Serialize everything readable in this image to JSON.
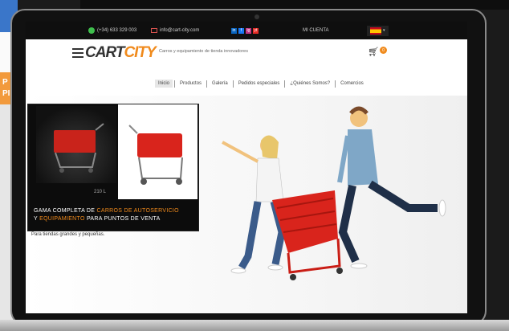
{
  "topbar": {
    "phone": "(+34) 633 329 003",
    "email": "info@cart-city.com",
    "account": "MI CUENTA",
    "socials": [
      "in",
      "f",
      "ig",
      "yt"
    ]
  },
  "header": {
    "logo_cart": "CART",
    "logo_city": "CITY",
    "tagline": "Carros y equipamiento de tienda innovadores",
    "cart_count": "0"
  },
  "nav": [
    "Inicio",
    "Productos",
    "Galería",
    "Pedidos especiales",
    "¿Quiénes Somos?",
    "Comercios"
  ],
  "promo": {
    "size_label": "210 L",
    "line1_a": "GAMA COMPLETA DE ",
    "line1_b": "CARROS DE AUTOSERVICIO",
    "line2_a": "Y ",
    "line2_b": "EQUIPAMIENTO",
    "line2_c": " PARA PUNTOS DE VENTA",
    "subtitle": "Para tiendas grandes y pequeñas."
  },
  "colors": {
    "accent": "#f08a1c",
    "topbar": "#0f0f0f",
    "cart_red": "#d9241c"
  }
}
